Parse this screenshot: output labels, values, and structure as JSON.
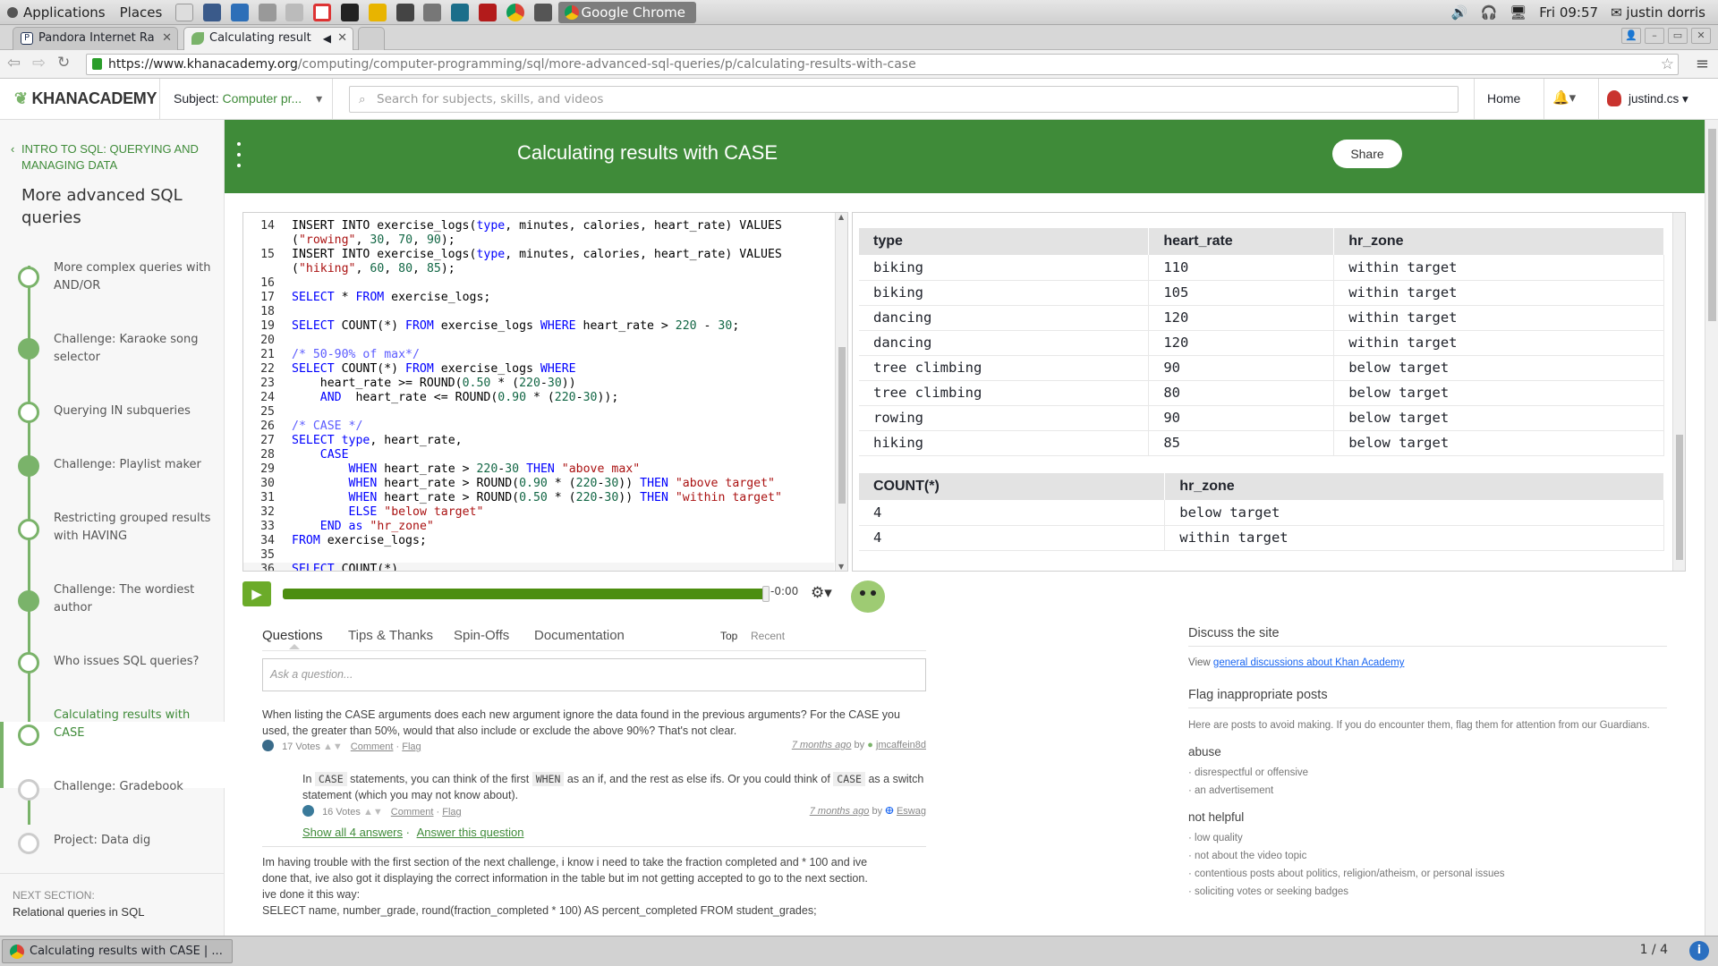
{
  "system_bar": {
    "applications": "Applications",
    "places": "Places",
    "running_app": "Google Chrome",
    "clock": "Fri 09:57",
    "user": "justin dorris"
  },
  "browser": {
    "tabs": [
      {
        "label": "Pandora Internet Ra",
        "active": false
      },
      {
        "label": "Calculating result",
        "active": true
      }
    ],
    "url_host": "https://www.khanacademy.org",
    "url_path": "/computing/computer-programming/sql/more-advanced-sql-queries/p/calculating-results-with-case"
  },
  "ka_header": {
    "logo": "KHANACADEMY",
    "subject_prefix": "Subject:",
    "subject_value": "Computer pr...",
    "search_placeholder": "Search for subjects, skills, and videos",
    "home": "Home",
    "username": "justind.cs"
  },
  "sidebar": {
    "section": "INTRO TO SQL: QUERYING AND MANAGING DATA",
    "title": "More advanced SQL queries",
    "items": [
      {
        "label": "More complex queries with AND/OR"
      },
      {
        "label": "Challenge: Karaoke song selector"
      },
      {
        "label": "Querying IN subqueries"
      },
      {
        "label": "Challenge: Playlist maker"
      },
      {
        "label": "Restricting grouped results with HAVING"
      },
      {
        "label": "Challenge: The wordiest author"
      },
      {
        "label": "Who issues SQL queries?"
      },
      {
        "label": "Calculating results with CASE"
      },
      {
        "label": "Challenge: Gradebook"
      },
      {
        "label": "Project: Data dig"
      }
    ],
    "next_label": "NEXT SECTION:",
    "next_value": "Relational queries in SQL"
  },
  "banner": {
    "title": "Calculating results with CASE",
    "share": "Share"
  },
  "code_lines": [
    {
      "n": "14",
      "t": "INSERT INTO exercise_logs(type, minutes, calories, heart_rate) VALUES"
    },
    {
      "n": "",
      "t": "(\"rowing\", 30, 70, 90);"
    },
    {
      "n": "15",
      "t": "INSERT INTO exercise_logs(type, minutes, calories, heart_rate) VALUES"
    },
    {
      "n": "",
      "t": "(\"hiking\", 60, 80, 85);"
    },
    {
      "n": "16",
      "t": ""
    },
    {
      "n": "17",
      "t": "SELECT * FROM exercise_logs;"
    },
    {
      "n": "18",
      "t": ""
    },
    {
      "n": "19",
      "t": "SELECT COUNT(*) FROM exercise_logs WHERE heart_rate > 220 - 30;"
    },
    {
      "n": "20",
      "t": ""
    },
    {
      "n": "21",
      "t": "/* 50-90% of max*/"
    },
    {
      "n": "22",
      "t": "SELECT COUNT(*) FROM exercise_logs WHERE"
    },
    {
      "n": "23",
      "t": "    heart_rate >= ROUND(0.50 * (220-30))"
    },
    {
      "n": "24",
      "t": "    AND  heart_rate <= ROUND(0.90 * (220-30));"
    },
    {
      "n": "25",
      "t": ""
    },
    {
      "n": "26",
      "t": "/* CASE */"
    },
    {
      "n": "27",
      "t": "SELECT type, heart_rate,"
    },
    {
      "n": "28",
      "t": "    CASE"
    },
    {
      "n": "29",
      "t": "        WHEN heart_rate > 220-30 THEN \"above max\""
    },
    {
      "n": "30",
      "t": "        WHEN heart_rate > ROUND(0.90 * (220-30)) THEN \"above target\""
    },
    {
      "n": "31",
      "t": "        WHEN heart_rate > ROUND(0.50 * (220-30)) THEN \"within target\""
    },
    {
      "n": "32",
      "t": "        ELSE \"below target\""
    },
    {
      "n": "33",
      "t": "    END as \"hr_zone\""
    },
    {
      "n": "34",
      "t": "FROM exercise_logs;"
    },
    {
      "n": "35",
      "t": ""
    },
    {
      "n": "36",
      "t": "SELECT COUNT(*),"
    }
  ],
  "table1": {
    "headers": [
      "type",
      "heart_rate",
      "hr_zone"
    ],
    "rows": [
      [
        "biking",
        "110",
        "within target"
      ],
      [
        "biking",
        "105",
        "within target"
      ],
      [
        "dancing",
        "120",
        "within target"
      ],
      [
        "dancing",
        "120",
        "within target"
      ],
      [
        "tree climbing",
        "90",
        "below target"
      ],
      [
        "tree climbing",
        "80",
        "below target"
      ],
      [
        "rowing",
        "90",
        "below target"
      ],
      [
        "hiking",
        "85",
        "below target"
      ]
    ]
  },
  "table2": {
    "headers": [
      "COUNT(*)",
      "hr_zone"
    ],
    "rows": [
      [
        "4",
        "below target"
      ],
      [
        "4",
        "within target"
      ]
    ]
  },
  "player": {
    "time": "-0:00",
    "progress": 1.0
  },
  "tabs_row": {
    "tabs": [
      "Questions",
      "Tips & Thanks",
      "Spin-Offs",
      "Documentation"
    ],
    "sort_top": "Top",
    "sort_recent": "Recent"
  },
  "ask_placeholder": "Ask a question...",
  "question1": {
    "text": "When listing the CASE arguments does each new argument ignore the data found in the previous arguments? For the CASE you used, the greater than 50%, would that also include or exclude the above 90%? That's not clear.",
    "votes": "17 Votes",
    "comment": "Comment",
    "flag": "Flag",
    "time": "7 months ago",
    "by": "by",
    "author": "jmcaffein8d"
  },
  "answer1": {
    "p1": "In",
    "c1": "CASE",
    "p2": "statements, you can think of the first",
    "c2": "WHEN",
    "p3": "as an if, and the rest as else ifs. Or you could think of",
    "c3": "CASE",
    "p4": "as a switch statement (which you may not know about).",
    "votes": "16 Votes",
    "comment": "Comment",
    "flag": "Flag",
    "time": "7 months ago",
    "by": "by",
    "author": "Eswag"
  },
  "show_answers": "Show all 4 answers",
  "answer_question": "Answer this question",
  "question2": {
    "line1": "Im having trouble with the first section of the next challenge, i know i need to take the fraction completed and * 100 and ive",
    "line2": "done that, ive also got it displaying the correct information in the table but im not getting accepted to go to the next section.",
    "line3": "ive done it this way:",
    "line4": "SELECT name, number_grade, round(fraction_completed * 100) AS percent_completed FROM student_grades;"
  },
  "right_panel": {
    "discuss_title": "Discuss the site",
    "view": "View",
    "discuss_link": "general discussions about Khan Academy",
    "flag_title": "Flag inappropriate posts",
    "flag_desc": "Here are posts to avoid making. If you do encounter them, flag them for attention from our Guardians.",
    "abuse_title": "abuse",
    "abuse_items": [
      "disrespectful or offensive",
      "an advertisement"
    ],
    "nothelpful_title": "not helpful",
    "nothelpful_items": [
      "low quality",
      "not about the video topic",
      "contentious posts about politics, religion/atheism, or personal issues",
      "soliciting votes or seeking badges"
    ]
  },
  "taskbar": {
    "window": "Calculating results with CASE | ...",
    "workspace": "1 / 4"
  },
  "colors": {
    "ka_green": "#3f8b39",
    "link_blue": "#1865f2"
  }
}
